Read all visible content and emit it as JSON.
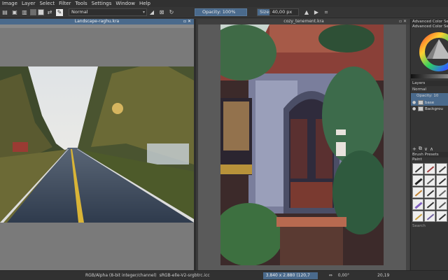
{
  "menu": [
    "Image",
    "Layer",
    "Select",
    "Filter",
    "Tools",
    "Settings",
    "Window",
    "Help"
  ],
  "toolbar": {
    "blend_mode": "Normal",
    "opacity": "Opacity: 100%",
    "opacity_level": 1.0,
    "size": "Size: 40,00 px",
    "icons": [
      "file-icon",
      "save-icon",
      "gradient-icon",
      "swatch-icon",
      "swap-colors-icon",
      "brush-preset-icon",
      "eraser-icon",
      "alpha-lock-icon",
      "reload-icon",
      "mirror-icon",
      "wrap-icon",
      "crop-icon"
    ]
  },
  "left_doc": {
    "title": "Landscape-raghu.kra"
  },
  "right_doc": {
    "title": "cozy_tenement.kra"
  },
  "dock": {
    "color_header": "Advanced Color Se",
    "color_sub": "Advanced Color Sel",
    "layers_header": "Layers",
    "blend_mode": "Normal",
    "opacity": "Opacity: 10",
    "layers": [
      {
        "name": "base",
        "selected": true
      },
      {
        "name": "Backgrou",
        "selected": false
      }
    ],
    "brush_header": "Brush Presets",
    "brush_tag": "Paint",
    "search": "Search"
  },
  "status": {
    "color_mode": "RGB/Alpha (8-bit integer/channel)",
    "profile": "sRGB-elle-V2-srgbtrc.icc",
    "dimensions": "3.840 x 2.880 (120,7 MiB)",
    "rotation": "0,00°",
    "zoom": "20,19"
  },
  "colors": {
    "accent": "#4a6a8c",
    "panel": "#353535",
    "canvas_bg": "#7a7a7a"
  }
}
